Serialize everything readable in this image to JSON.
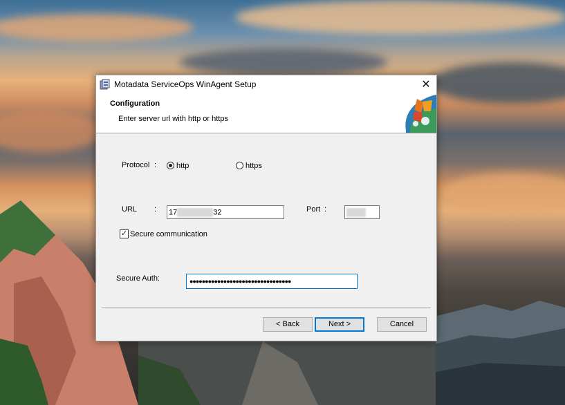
{
  "window": {
    "title": "Motadata ServiceOps WinAgent Setup",
    "close_glyph": "✕"
  },
  "banner": {
    "title": "Configuration",
    "subtitle": "Enter server url with http or https",
    "logo_icon": "motadata-puzzle-logo"
  },
  "form": {
    "protocol_label": "Protocol",
    "colon": ":",
    "protocol_options": [
      {
        "label": "http",
        "selected": true
      },
      {
        "label": "https",
        "selected": false
      }
    ],
    "url_label": "URL",
    "url_value_prefix": "17",
    "url_value_suffix": "32",
    "port_label": "Port",
    "port_colon": ":",
    "secure_comm_label": "Secure communication",
    "secure_comm_checked": true,
    "check_glyph": "✓",
    "secure_auth_label": "Secure Auth:",
    "secure_auth_value": "●●●●●●●●●●●●●●●●●●●●●●●●●●●●●●●●●"
  },
  "buttons": {
    "back": "< Back",
    "next": "Next >",
    "cancel": "Cancel"
  }
}
